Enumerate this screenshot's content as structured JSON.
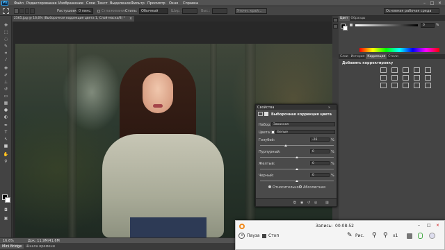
{
  "app": {
    "logo": "Ps"
  },
  "menu": [
    "Файл",
    "Редактирование",
    "Изображение",
    "Слои",
    "Текст",
    "Выделение",
    "Фильтр",
    "Просмотр",
    "Окно",
    "Справка"
  ],
  "window_controls": [
    "–",
    "□",
    "×"
  ],
  "options_bar": {
    "feather_label": "Растушевка:",
    "feather_value": "0 пикс.",
    "antialias_label": "Сглаживание",
    "style_label": "Стиль:",
    "style_value": "Обычный",
    "width_label": "Шир.:",
    "height_label": "Выс.:",
    "refine_button": "Уточн. край...",
    "workspace_value": "Основная рабочая среда"
  },
  "document_tab": {
    "title": "2565.jpg @ 16,6% (Выборочная коррекция цвета 1, Слой-маска/8) *",
    "close": "×"
  },
  "right_panels": {
    "top_tabs": [
      "Цвет",
      "Образцы"
    ],
    "mid_tabs": [
      "Слои",
      "История",
      "Коррекция",
      "Стили"
    ],
    "active_mid_tab": "Коррекция",
    "add_adjustment": "Добавить корректировку",
    "slider_value": "0"
  },
  "properties": {
    "tabs": [
      "Свойства"
    ],
    "panel_title": "Выборочная коррекция цвета",
    "preset_label": "Набор:",
    "preset_value": "Заказная",
    "colors_label": "Цвета:",
    "colors_value": "Белые",
    "sliders": [
      {
        "label": "Голубой:",
        "value": "-26",
        "unit": "%",
        "position": 0.37
      },
      {
        "label": "Пурпурный:",
        "value": "0",
        "unit": "%",
        "position": 0.5
      },
      {
        "label": "Желтый:",
        "value": "0",
        "unit": "%",
        "position": 0.5
      },
      {
        "label": "Черный:",
        "value": "0",
        "unit": "%",
        "position": 0.5
      }
    ],
    "method_options": [
      "Относительно",
      "Абсолютная"
    ],
    "selected_method": "Относительно"
  },
  "status_bar": {
    "zoom": "16,6%",
    "doc_info": "Док: 11,9М/41,6М"
  },
  "bottom_tabs": [
    "Mini Bridge",
    "Шкала времени"
  ],
  "recorder": {
    "recording_label": "Запись:",
    "recording_time": "00:08:52",
    "pause_label": "Пауза",
    "stop_label": "Стоп",
    "draw_label": "Рис.",
    "zoom_label": "x1",
    "window_controls": [
      "–",
      "□",
      "×"
    ]
  },
  "colors": {
    "accent_ps": "#2aa8ff",
    "recorder_orange": "#f08a1c"
  }
}
